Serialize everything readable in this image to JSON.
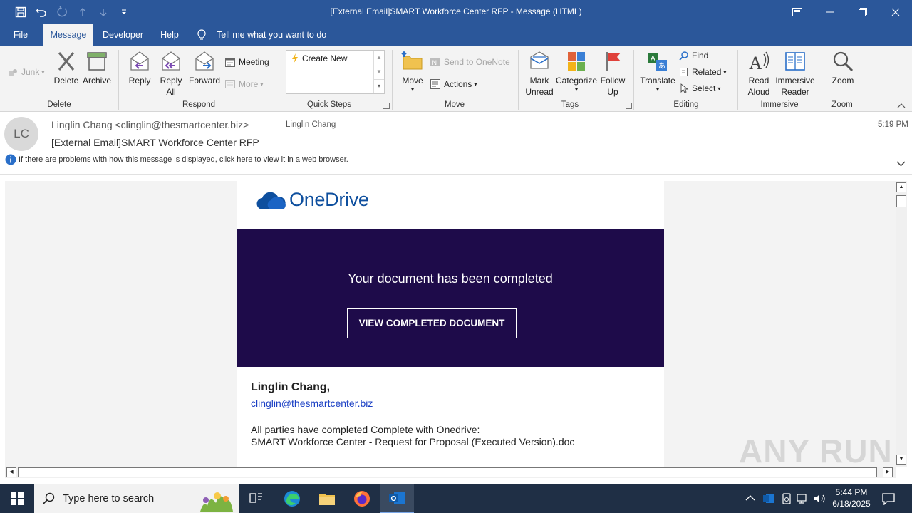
{
  "window": {
    "title": "[External Email]SMART Workforce Center RFP  -  Message (HTML)"
  },
  "menu_tabs": {
    "file": "File",
    "message": "Message",
    "developer": "Developer",
    "help": "Help",
    "tell_me": "Tell me what you want to do"
  },
  "ribbon": {
    "junk": "Junk",
    "delete": "Delete",
    "archive": "Archive",
    "group_delete": "Delete",
    "reply": "Reply",
    "reply_all_1": "Reply",
    "reply_all_2": "All",
    "forward": "Forward",
    "meeting": "Meeting",
    "more": "More",
    "group_respond": "Respond",
    "create_new": "Create New",
    "group_quick_steps": "Quick Steps",
    "move": "Move",
    "send_onenote": "Send to OneNote",
    "actions": "Actions",
    "group_move": "Move",
    "mark_unread_1": "Mark",
    "mark_unread_2": "Unread",
    "categorize": "Categorize",
    "follow_up_1": "Follow",
    "follow_up_2": "Up",
    "group_tags": "Tags",
    "translate": "Translate",
    "find": "Find",
    "related": "Related",
    "select": "Select",
    "group_editing": "Editing",
    "read_aloud_1": "Read",
    "read_aloud_2": "Aloud",
    "immersive_1": "Immersive",
    "immersive_2": "Reader",
    "group_immersive": "Immersive",
    "zoom": "Zoom",
    "group_zoom": "Zoom"
  },
  "message": {
    "avatar_initials": "LC",
    "from": "Linglin Chang <clinglin@thesmartcenter.biz>",
    "to": "Linglin Chang",
    "time": "5:19 PM",
    "subject": "[External Email]SMART Workforce Center RFP",
    "info_bar": "If there are problems with how this message is displayed, click here to view it in a web browser."
  },
  "email_body": {
    "brand": "OneDrive",
    "headline": "Your document has been completed",
    "cta": "VIEW COMPLETED DOCUMENT",
    "greeting": "Linglin Chang,",
    "email_link": "clinglin@thesmartcenter.biz",
    "line1": "All parties have completed Complete with Onedrive:",
    "line2": "SMART Workforce Center - Request for Proposal (Executed Version).doc"
  },
  "taskbar": {
    "search_placeholder": "Type here to search",
    "clock_time": "5:44 PM",
    "clock_date": "6/18/2025"
  },
  "watermark": "ANY RUN",
  "colors": {
    "outlook_blue": "#2b579a",
    "banner_purple": "#1e0b4a",
    "onedrive_blue": "#0e4f9e",
    "taskbar": "#1f2f45"
  }
}
